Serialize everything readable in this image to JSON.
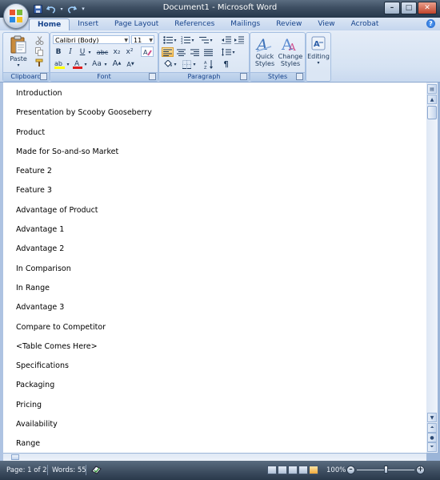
{
  "window": {
    "title": "Document1 - Microsoft Word"
  },
  "tabs": [
    {
      "label": "Home",
      "active": true
    },
    {
      "label": "Insert"
    },
    {
      "label": "Page Layout"
    },
    {
      "label": "References"
    },
    {
      "label": "Mailings"
    },
    {
      "label": "Review"
    },
    {
      "label": "View"
    },
    {
      "label": "Acrobat"
    }
  ],
  "ribbon": {
    "clipboard": {
      "label": "Clipboard",
      "paste": "Paste"
    },
    "font": {
      "label": "Font",
      "font_name": "Calibri (Body)",
      "font_size": "11",
      "bold": "B",
      "italic": "I",
      "underline": "U",
      "strike": "abc",
      "subscript": "x₂",
      "superscript": "x²",
      "change_case": "Aa",
      "grow": "A",
      "shrink": "A"
    },
    "paragraph": {
      "label": "Paragraph"
    },
    "styles": {
      "label": "Styles",
      "quick_l1": "Quick",
      "quick_l2": "Styles",
      "change_l1": "Change",
      "change_l2": "Styles"
    },
    "editing": {
      "label": "Editing"
    }
  },
  "document": {
    "lines": [
      "Introduction",
      "Presentation by Scooby Gooseberry",
      "Product",
      "Made for So-and-so Market",
      "Feature 2",
      "Feature 3",
      "Advantage of Product",
      "Advantage 1",
      "Advantage 2",
      "In Comparison",
      "In Range",
      "Advantage 3",
      "Compare to Competitor",
      "<Table Comes Here>",
      "Specifications",
      "Packaging",
      "Pricing",
      "Availability",
      "Range"
    ]
  },
  "status": {
    "page": "Page: 1 of 2",
    "words": "Words: 55",
    "zoom": "100%"
  },
  "colors": {
    "ribbon_bg": "#dbe6f4",
    "titlebar": "#3d4e62",
    "accent": "#f7c05b"
  }
}
